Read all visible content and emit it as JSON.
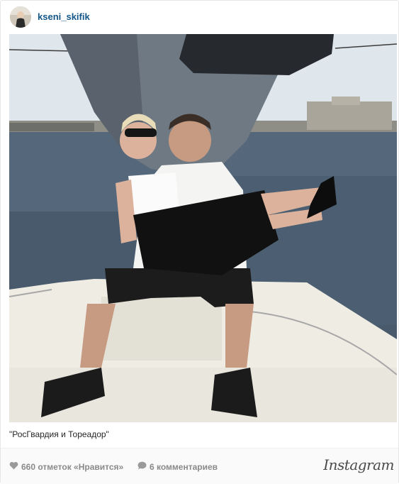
{
  "post": {
    "username": "kseni_skifik",
    "caption": "\"РосГвардия и Тореадор\"",
    "likes_text": "660 отметок «Нравится»",
    "comments_text": "6 комментариев",
    "brand": "Instagram"
  },
  "icons": {
    "likes": "heart-icon",
    "comments": "comment-bubble-icon"
  },
  "colors": {
    "username": "#125688",
    "meta_text": "#8a8a8a",
    "caption_text": "#262626",
    "footer_bg": "#fafafa"
  }
}
